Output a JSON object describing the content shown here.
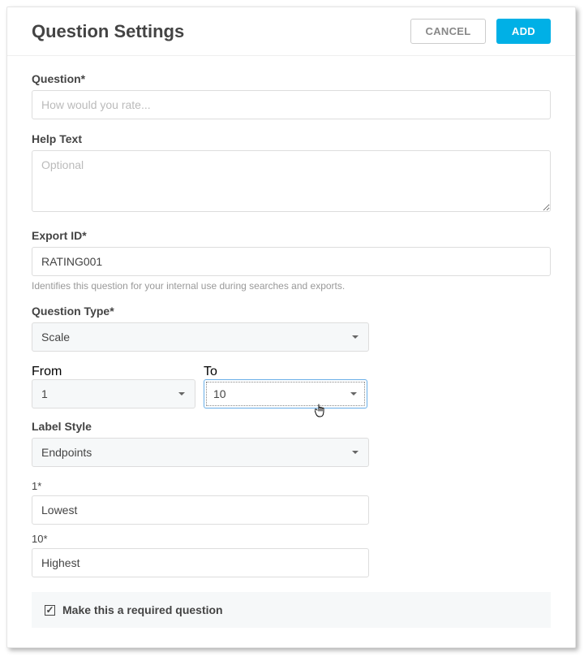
{
  "header": {
    "title": "Question Settings",
    "cancel": "CANCEL",
    "add": "ADD"
  },
  "question": {
    "label": "Question*",
    "placeholder": "How would you rate..."
  },
  "helptext": {
    "label": "Help Text",
    "placeholder": "Optional"
  },
  "exportid": {
    "label": "Export ID*",
    "value": "RATING001",
    "hint": "Identifies this question for your internal use during searches and exports."
  },
  "qtype": {
    "label": "Question Type*",
    "value": "Scale"
  },
  "from": {
    "label": "From",
    "value": "1"
  },
  "to": {
    "label": "To",
    "value": "10"
  },
  "labelstyle": {
    "label": "Label Style",
    "value": "Endpoints"
  },
  "ep1": {
    "label": "1*",
    "value": "Lowest"
  },
  "ep2": {
    "label": "10*",
    "value": "Highest"
  },
  "required": {
    "label": "Make this a required question",
    "checked": true
  }
}
